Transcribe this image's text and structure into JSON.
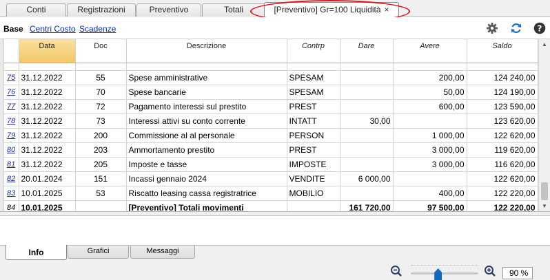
{
  "tabs": [
    {
      "label": "Conti"
    },
    {
      "label": "Registrazioni"
    },
    {
      "label": "Preventivo"
    },
    {
      "label": "Totali"
    },
    {
      "label": "[Preventivo] Gr=100 Liquidità",
      "close": "×"
    }
  ],
  "subbar": {
    "base": "Base",
    "links": [
      "Centri Costo",
      "Scadenze"
    ]
  },
  "toolbar_icons": [
    "gear-icon",
    "refresh-icon",
    "help-icon"
  ],
  "columns": [
    "",
    "Data",
    "Doc",
    "Descrizione",
    "Contrp",
    "Dare",
    "Avere",
    "Saldo"
  ],
  "rows": [
    {
      "n": "75",
      "date": "31.12.2022",
      "doc": "55",
      "desc": "Spese amministrative",
      "contrp": "SPESAM",
      "dare": "",
      "avere": "200,00",
      "saldo": "124 240,00"
    },
    {
      "n": "76",
      "date": "31.12.2022",
      "doc": "70",
      "desc": "Spese bancarie",
      "contrp": "SPESAM",
      "dare": "",
      "avere": "50,00",
      "saldo": "124 190,00"
    },
    {
      "n": "77",
      "date": "31.12.2022",
      "doc": "72",
      "desc": "Pagamento interessi sul prestito",
      "contrp": "PREST",
      "dare": "",
      "avere": "600,00",
      "saldo": "123 590,00"
    },
    {
      "n": "78",
      "date": "31.12.2022",
      "doc": "73",
      "desc": "Interessi attivi su conto corrente",
      "contrp": "INTATT",
      "dare": "30,00",
      "avere": "",
      "saldo": "123 620,00"
    },
    {
      "n": "79",
      "date": "31.12.2022",
      "doc": "200",
      "desc": "Commissione al al personale",
      "contrp": "PERSON",
      "dare": "",
      "avere": "1 000,00",
      "saldo": "122 620,00"
    },
    {
      "n": "80",
      "date": "31.12.2022",
      "doc": "203",
      "desc": "Ammortamento prestito",
      "contrp": "PREST",
      "dare": "",
      "avere": "3 000,00",
      "saldo": "119 620,00"
    },
    {
      "n": "81",
      "date": "31.12.2022",
      "doc": "205",
      "desc": "Imposte e tasse",
      "contrp": "IMPOSTE",
      "dare": "",
      "avere": "3 000,00",
      "saldo": "116 620,00"
    },
    {
      "n": "82",
      "date": "20.01.2024",
      "doc": "151",
      "desc": "Incassi gennaio 2024",
      "contrp": "VENDITE",
      "dare": "6 000,00",
      "avere": "",
      "saldo": "122 620,00"
    },
    {
      "n": "83",
      "date": "10.01.2025",
      "doc": "53",
      "desc": "Riscatto leasing cassa registratrice",
      "contrp": "MOBILIO",
      "dare": "",
      "avere": "400,00",
      "saldo": "122 220,00"
    }
  ],
  "total": {
    "n": "84",
    "date": "10.01.2025",
    "doc": "",
    "desc": "[Preventivo] Totali movimenti",
    "contrp": "",
    "dare": "161 720,00",
    "avere": "97 500,00",
    "saldo": "122 220,00"
  },
  "bottom_tabs": [
    "Info",
    "Grafici",
    "Messaggi"
  ],
  "zoom": {
    "value": "90 %",
    "level_percent": 40
  }
}
